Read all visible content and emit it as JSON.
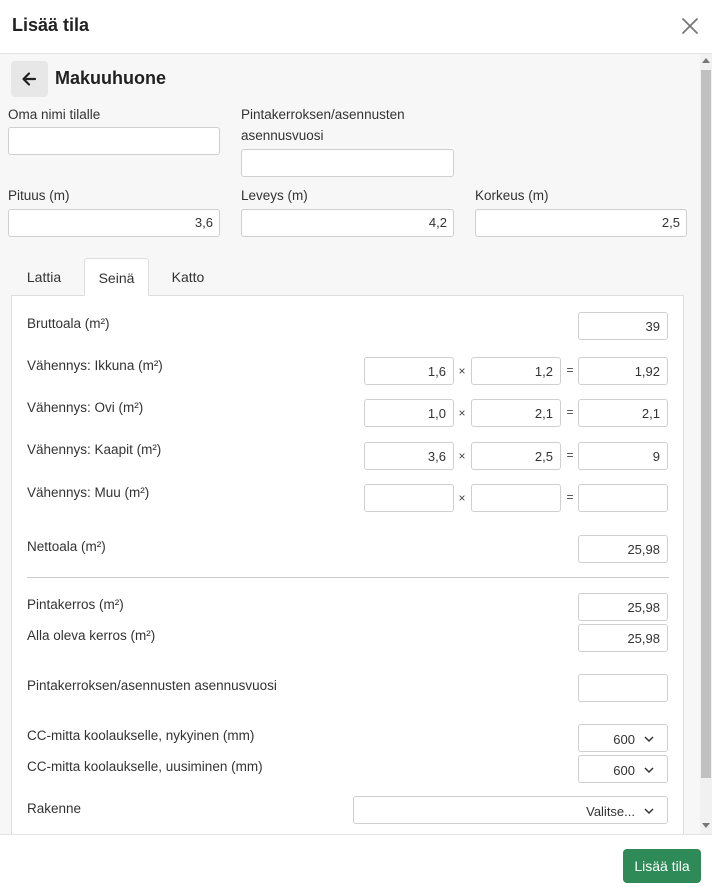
{
  "modal": {
    "title": "Lisää tila"
  },
  "room": {
    "title": "Makuuhuone"
  },
  "fields": {
    "own_name_label": "Oma nimi tilalle",
    "own_name_value": "",
    "install_year_label": "Pintakerroksen/asennusten asennusvuosi",
    "install_year_value": "",
    "length_label": "Pituus (m)",
    "length_value": "3,6",
    "width_label": "Leveys (m)",
    "width_value": "4,2",
    "height_label": "Korkeus (m)",
    "height_value": "2,5"
  },
  "tabs": [
    {
      "label": "Lattia",
      "active": false
    },
    {
      "label": "Seinä",
      "active": true
    },
    {
      "label": "Katto",
      "active": false
    }
  ],
  "panel": {
    "gross": {
      "label": "Bruttoala (m²)",
      "value": "39"
    },
    "reductions": [
      {
        "label": "Vähennys: Ikkuna (m²)",
        "a": "1,6",
        "b": "1,2",
        "result": "1,92"
      },
      {
        "label": "Vähennys: Ovi (m²)",
        "a": "1,0",
        "b": "2,1",
        "result": "2,1"
      },
      {
        "label": "Vähennys: Kaapit (m²)",
        "a": "3,6",
        "b": "2,5",
        "result": "9"
      },
      {
        "label": "Vähennys: Muu (m²)",
        "a": "",
        "b": "",
        "result": ""
      }
    ],
    "times_symbol": "×",
    "equals_symbol": "=",
    "net": {
      "label": "Nettoala (m²)",
      "value": "25,98"
    },
    "surface_layer": {
      "label": "Pintakerros (m²)",
      "value": "25,98"
    },
    "under_layer": {
      "label": "Alla oleva kerros (m²)",
      "value": "25,98"
    },
    "install_year": {
      "label": "Pintakerroksen/asennusten asennusvuosi",
      "value": ""
    },
    "cc_current": {
      "label": "CC-mitta koolaukselle, nykyinen (mm)",
      "value": "600"
    },
    "cc_renewal": {
      "label": "CC-mitta koolaukselle, uusiminen (mm)",
      "value": "600"
    },
    "structure": {
      "label": "Rakenne",
      "value": "Valitse..."
    }
  },
  "footer": {
    "add_label": "Lisää tila"
  },
  "colors": {
    "primary": "#2e8b57",
    "body_bg": "#f7f7f7"
  }
}
